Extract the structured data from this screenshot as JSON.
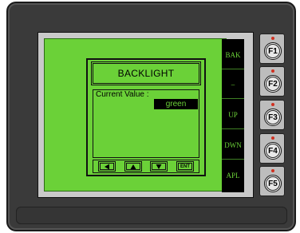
{
  "dialog": {
    "title": "BACKLIGHT",
    "current_value_label": "Current Value :",
    "current_value": "green",
    "ent_label": "ENT"
  },
  "softkeys": [
    {
      "label": "BAK"
    },
    {
      "label": "–"
    },
    {
      "label": "UP"
    },
    {
      "label": "DWN"
    },
    {
      "label": "APL"
    }
  ],
  "function_keys": [
    {
      "label": "F1"
    },
    {
      "label": "F2"
    },
    {
      "label": "F3"
    },
    {
      "label": "F4"
    },
    {
      "label": "F5"
    }
  ],
  "colors": {
    "screen": "#6bd138",
    "bezel": "#c9c9c9",
    "housing": "#3a3a3a",
    "led": "#d03020"
  }
}
